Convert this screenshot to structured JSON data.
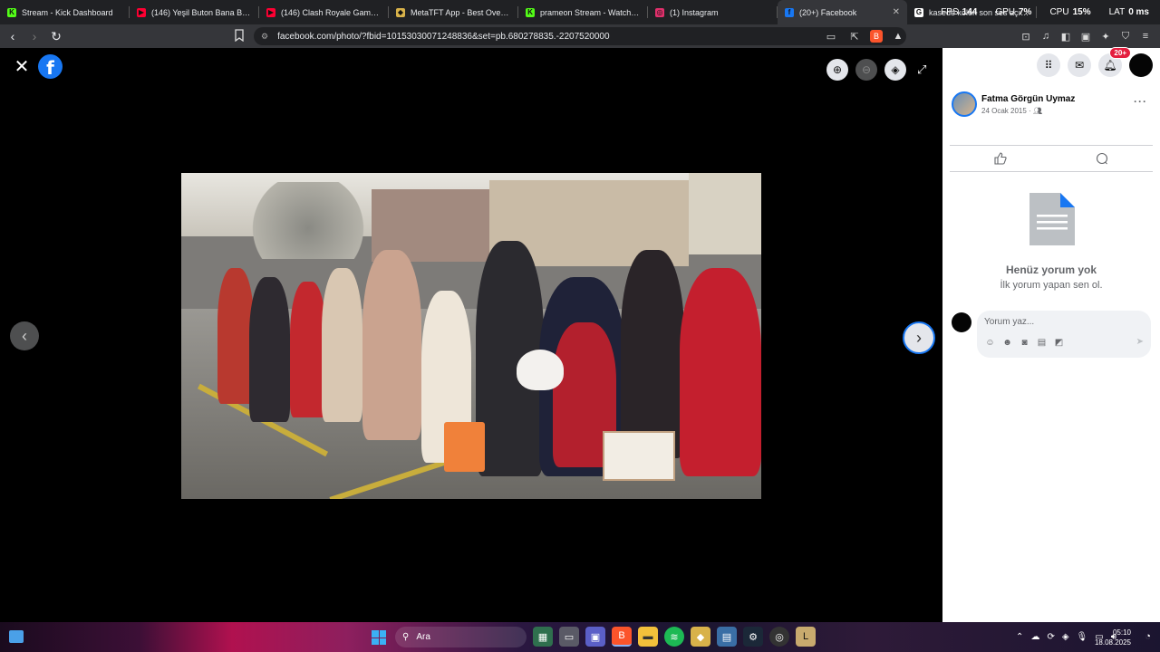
{
  "tabs": [
    {
      "title": "Stream - Kick Dashboard",
      "color": "#53fc18",
      "glyph": "K"
    },
    {
      "title": "(146) Yeşil Buton Bana Bastı - Y",
      "color": "#ff0033",
      "glyph": "▶"
    },
    {
      "title": "(146) Clash Royale Game Play #",
      "color": "#ff0033",
      "glyph": "▶"
    },
    {
      "title": "MetaTFT App - Best Overlay De",
      "color": "#d8b24a",
      "glyph": "◆"
    },
    {
      "title": "prameon Stream - Watch Live o",
      "color": "#53fc18",
      "glyph": "K"
    },
    {
      "title": "(1) Instagram",
      "color": "#e1306c",
      "glyph": "◎"
    },
    {
      "title": "(20+) Facebook",
      "color": "#1877f2",
      "glyph": "f",
      "active": true
    },
    {
      "title": "kasede kolon son ses açık - Go",
      "color": "#ffffff",
      "glyph": "G"
    }
  ],
  "perf": {
    "fps_label": "FPS",
    "fps": "144",
    "gpu_label": "GPU",
    "gpu": "7%",
    "cpu_label": "CPU",
    "cpu": "15%",
    "lat_label": "LAT",
    "lat": "0 ms"
  },
  "address": {
    "url": "facebook.com/photo/?fbid=10153030071248836&set=pb.680278835.-2207520000"
  },
  "panel": {
    "notifications_badge": "20+",
    "author_name": "Fatma Görgün Uymaz",
    "post_date": "24 Ocak 2015 ·",
    "no_comments_title": "Henüz yorum yok",
    "no_comments_sub": "İlk yorum yapan sen ol.",
    "comment_placeholder": "Yorum yaz..."
  },
  "taskbar": {
    "search_label": "Ara",
    "time": "05:10",
    "date": "18.08.2025"
  }
}
